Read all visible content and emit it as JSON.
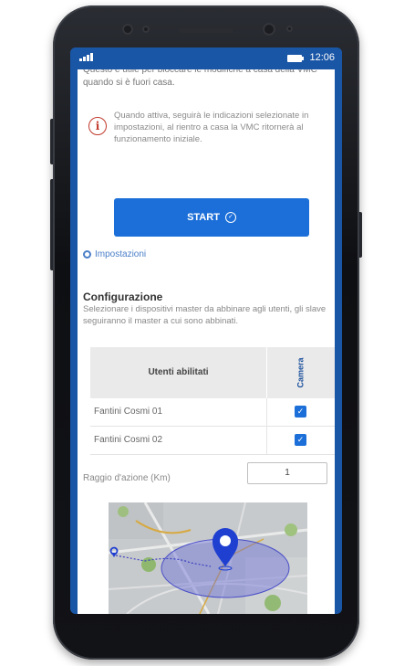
{
  "status_bar": {
    "time": "12:06"
  },
  "intro": {
    "cut_off_text": "Questo è utile per bloccare le modifiche a casa della VMC quando si è fuori casa."
  },
  "info_box": {
    "text": "Quando attiva, seguirà le indicazioni selezionate in impostazioni, al rientro a casa la VMC ritornerà al funzionamento iniziale."
  },
  "start_button": {
    "label": "START"
  },
  "settings_link": {
    "label": "Impostazioni"
  },
  "configuration": {
    "title": "Configurazione",
    "description": "Selezionare i dispositivi master da abbinare agli utenti, gli slave seguiranno il master a cui sono abbinati."
  },
  "users_table": {
    "headers": {
      "users": "Utenti abilitati",
      "room": "Camera"
    },
    "rows": [
      {
        "name": "Fantini Cosmi 01",
        "checked": true
      },
      {
        "name": "Fantini Cosmi 02",
        "checked": true
      }
    ]
  },
  "radius": {
    "label": "Raggio d'azione (Km)",
    "value": "1"
  },
  "colors": {
    "brand_blue": "#1a56a6",
    "button_blue": "#1c6fd8",
    "info_red": "#c0392b",
    "map_pin": "#1f3fd1"
  }
}
